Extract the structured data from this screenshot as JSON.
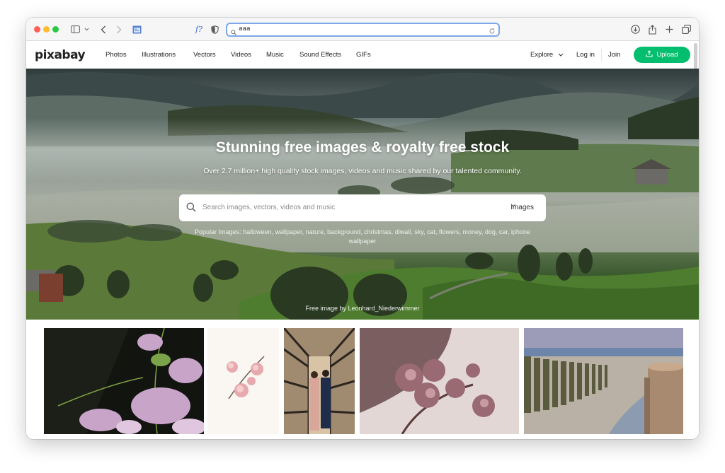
{
  "browser": {
    "url": "aaa",
    "icons": [
      "sidebar-icon",
      "chevron-down-icon",
      "back-icon",
      "forward-icon",
      "tab-icon",
      "font-icon",
      "shield-icon",
      "download-icon",
      "share-icon",
      "plus-icon",
      "tabs-overview-icon"
    ]
  },
  "nav": {
    "logo": "pixabay",
    "items": [
      "Photos",
      "Illustrations",
      "Vectors",
      "Videos",
      "Music",
      "Sound Effects",
      "GIFs"
    ],
    "explore": "Explore",
    "login": "Log in",
    "join": "Join",
    "upload": "Upload"
  },
  "hero": {
    "title": "Stunning free images & royalty free stock",
    "subtitle": "Over 2.7 million+ high quality stock images, videos and music shared by our talented community.",
    "search_placeholder": "Search images, vectors, videos and music",
    "search_type": "Images",
    "popular": "Popular Images: halloween, wallpaper, nature, background, christmas, diwali, sky, cat, flowers, money, dog, car, iphone wallpaper",
    "credit": "Free image by Leonhard_Niederwimmer"
  },
  "colors": {
    "accent": "#02be6e",
    "url_focus": "#7da7e8"
  }
}
